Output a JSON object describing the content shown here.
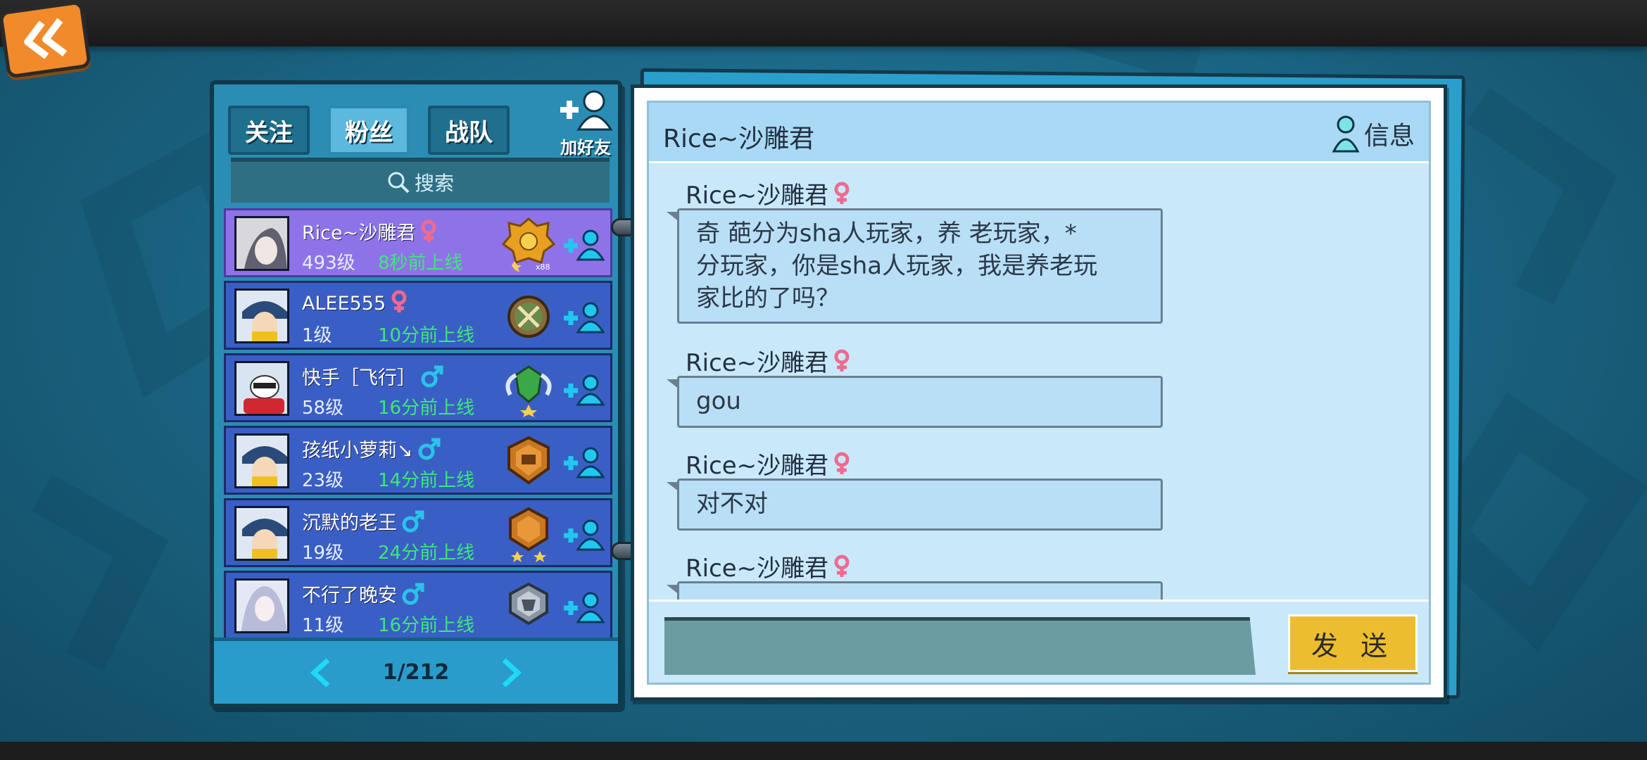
{
  "tabs": [
    {
      "label": "关注",
      "active": false
    },
    {
      "label": "粉丝",
      "active": true
    },
    {
      "label": "战队",
      "active": false
    }
  ],
  "add_friend_label": "加好友",
  "search_label": "搜索",
  "friends": [
    {
      "name": "Rice~沙雕君",
      "gender": "female",
      "level": "493级",
      "status": "8秒前上线",
      "badge": "gold-crown-badge",
      "badge_text": "x88",
      "selected": true
    },
    {
      "name": "ALEE555",
      "gender": "female",
      "level": "1级",
      "status": "10分前上线",
      "badge": "bronze-sword-badge",
      "badge_text": "",
      "selected": false
    },
    {
      "name": "快手［飞行］",
      "gender": "male",
      "level": "58级",
      "status": "16分前上线",
      "badge": "green-wing-badge",
      "badge_text": "",
      "selected": false
    },
    {
      "name": "孩纸小萝莉↘",
      "gender": "male",
      "level": "23级",
      "status": "14分前上线",
      "badge": "bronze-shield-badge",
      "badge_text": "",
      "selected": false
    },
    {
      "name": "沉默的老王",
      "gender": "male",
      "level": "19级",
      "status": "24分前上线",
      "badge": "bronze-star-badge",
      "badge_text": "",
      "selected": false
    },
    {
      "name": "不行了晚安",
      "gender": "male",
      "level": "11级",
      "status": "16分前上线",
      "badge": "silver-badge",
      "badge_text": "",
      "selected": false
    }
  ],
  "pager": {
    "text": "1/212"
  },
  "chat": {
    "title": "Rice~沙雕君",
    "info_label": "信息",
    "messages": [
      {
        "sender": "Rice~沙雕君",
        "text": "奇 葩分为sha人玩家，养 老玩家，*\n分玩家，你是sha人玩家，我是养老玩\n家比的了吗？"
      },
      {
        "sender": "Rice~沙雕君",
        "text": "gou"
      },
      {
        "sender": "Rice~沙雕君",
        "text": "对不对"
      },
      {
        "sender": "Rice~沙雕君",
        "text": ""
      }
    ],
    "input_value": "",
    "send_label": "发 送"
  },
  "colors": {
    "selected_row": "#8e73e8",
    "row": "#3a5fc4",
    "online_text": "#3de87a",
    "send_button": "#ecbd2e",
    "female": "#f06a8e",
    "male": "#29c4e8"
  }
}
